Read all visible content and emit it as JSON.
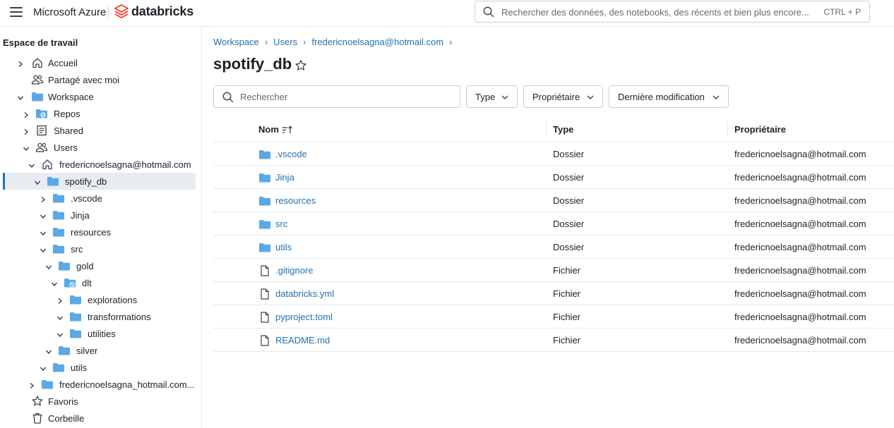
{
  "topbar": {
    "brand_azure": "Microsoft Azure",
    "brand_databricks": "databricks",
    "search_placeholder": "Rechercher des données, des notebooks, des récents et bien plus encore...",
    "search_shortcut": "CTRL + P"
  },
  "sidebar": {
    "title": "Espace de travail",
    "items": [
      {
        "label": "Accueil",
        "icon": "home-icon",
        "chevron": "right"
      },
      {
        "label": "Partagé avec moi",
        "icon": "users-icon",
        "chevron": "none"
      },
      {
        "label": "Workspace",
        "icon": "folder-icon",
        "chevron": "down"
      },
      {
        "label": "Repos",
        "icon": "repos-folder-icon",
        "chevron": "right"
      },
      {
        "label": "Shared",
        "icon": "shared-icon",
        "chevron": "right"
      },
      {
        "label": "Users",
        "icon": "users-icon",
        "chevron": "down"
      },
      {
        "label": "fredericnoelsagna@hotmail.com",
        "icon": "home-icon",
        "chevron": "down"
      },
      {
        "label": "spotify_db",
        "icon": "folder-icon",
        "chevron": "down"
      },
      {
        "label": ".vscode",
        "icon": "folder-icon",
        "chevron": "right"
      },
      {
        "label": "Jinja",
        "icon": "folder-icon",
        "chevron": "down"
      },
      {
        "label": "resources",
        "icon": "folder-icon",
        "chevron": "down"
      },
      {
        "label": "src",
        "icon": "folder-icon",
        "chevron": "down"
      },
      {
        "label": "gold",
        "icon": "folder-icon",
        "chevron": "down"
      },
      {
        "label": "dlt",
        "icon": "pipeline-folder-icon",
        "chevron": "down"
      },
      {
        "label": "explorations",
        "icon": "folder-icon",
        "chevron": "right"
      },
      {
        "label": "transformations",
        "icon": "folder-icon",
        "chevron": "down"
      },
      {
        "label": "utilities",
        "icon": "folder-icon",
        "chevron": "down"
      },
      {
        "label": "silver",
        "icon": "folder-icon",
        "chevron": "down"
      },
      {
        "label": "utils",
        "icon": "folder-icon",
        "chevron": "down"
      },
      {
        "label": "fredericnoelsagna_hotmail.com...",
        "icon": "folder-icon",
        "chevron": "right"
      },
      {
        "label": "Favoris",
        "icon": "star-icon",
        "chevron": "none"
      },
      {
        "label": "Corbeille",
        "icon": "trash-icon",
        "chevron": "none"
      }
    ]
  },
  "main": {
    "breadcrumb": [
      "Workspace",
      "Users",
      "fredericnoelsagna@hotmail.com"
    ],
    "title": "spotify_db",
    "search_placeholder": "Rechercher",
    "filters": [
      "Type",
      "Propriétaire",
      "Dernière modification"
    ],
    "columns": {
      "name": "Nom",
      "type": "Type",
      "owner": "Propriétaire"
    },
    "rows": [
      {
        "name": ".vscode",
        "type": "Dossier",
        "owner": "fredericnoelsagna@hotmail.com",
        "icon": "folder-icon"
      },
      {
        "name": "Jinja",
        "type": "Dossier",
        "owner": "fredericnoelsagna@hotmail.com",
        "icon": "folder-icon"
      },
      {
        "name": "resources",
        "type": "Dossier",
        "owner": "fredericnoelsagna@hotmail.com",
        "icon": "folder-icon"
      },
      {
        "name": "src",
        "type": "Dossier",
        "owner": "fredericnoelsagna@hotmail.com",
        "icon": "folder-icon"
      },
      {
        "name": "utils",
        "type": "Dossier",
        "owner": "fredericnoelsagna@hotmail.com",
        "icon": "folder-icon"
      },
      {
        "name": ".gitignore",
        "type": "Fichier",
        "owner": "fredericnoelsagna@hotmail.com",
        "icon": "file-icon"
      },
      {
        "name": "databricks.yml",
        "type": "Fichier",
        "owner": "fredericnoelsagna@hotmail.com",
        "icon": "file-icon"
      },
      {
        "name": "pyproject.toml",
        "type": "Fichier",
        "owner": "fredericnoelsagna@hotmail.com",
        "icon": "file-icon"
      },
      {
        "name": "README.md",
        "type": "Fichier",
        "owner": "fredericnoelsagna@hotmail.com",
        "icon": "file-icon"
      }
    ]
  },
  "colors": {
    "link": "#2272b4",
    "folder": "#5aa8e6",
    "selected_bg": "#e6ecf2",
    "text": "#1b2128"
  }
}
